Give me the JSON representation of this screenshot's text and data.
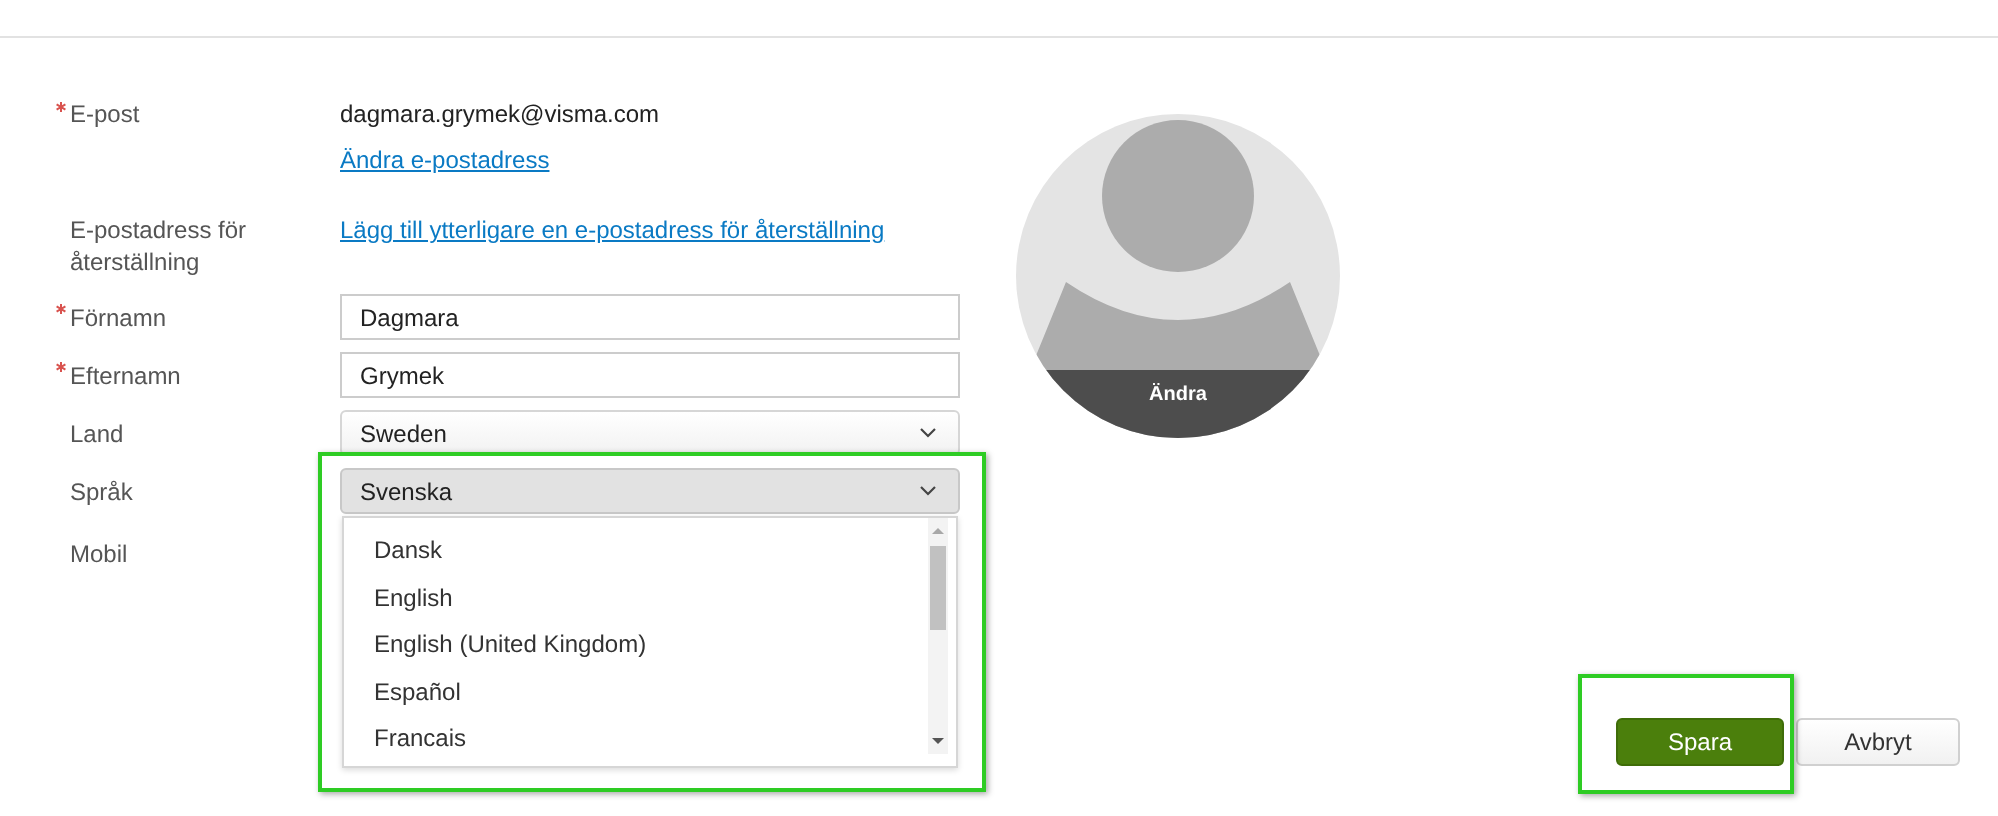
{
  "form": {
    "rows": [
      {
        "kind": "text",
        "label": "E-post",
        "required": true,
        "value": "dagmara.grymek@visma.com",
        "link": "Ändra e-postadress"
      },
      {
        "kind": "link",
        "label": "E-postadress för återställning",
        "required": false,
        "link": "Lägg till ytterligare en e-postadress för återställning"
      },
      {
        "kind": "input",
        "label": "Förnamn",
        "required": true,
        "value": "Dagmara"
      },
      {
        "kind": "input",
        "label": "Efternamn",
        "required": true,
        "value": "Grymek"
      },
      {
        "kind": "select",
        "label": "Land",
        "required": false,
        "value": "Sweden",
        "open": false
      },
      {
        "kind": "select",
        "label": "Språk",
        "required": false,
        "value": "Svenska",
        "open": true,
        "options": [
          "Dansk",
          "English",
          "English (United Kingdom)",
          "Español",
          "Francais"
        ]
      },
      {
        "kind": "blank",
        "label": "Mobil",
        "required": false
      }
    ]
  },
  "avatar": {
    "action": "Ändra"
  },
  "buttons": [
    {
      "label": "Spara",
      "kind": "primary"
    },
    {
      "label": "Avbryt",
      "kind": "secondary"
    }
  ]
}
